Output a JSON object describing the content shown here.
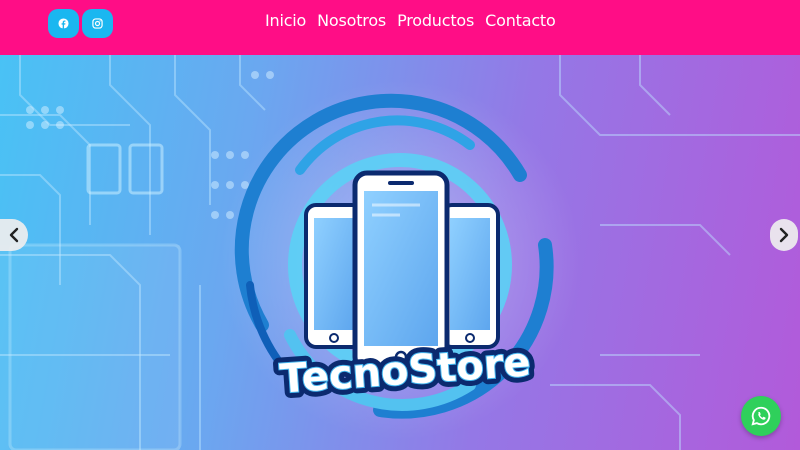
{
  "header": {
    "background": "#ff0d86",
    "social": [
      {
        "name": "facebook",
        "icon": "facebook-icon",
        "color": "#1ab7f0"
      },
      {
        "name": "instagram",
        "icon": "instagram-icon",
        "color": "#1ab7f0"
      }
    ],
    "nav": [
      "Inicio",
      "Nosotros",
      "Productos",
      "Contacto"
    ]
  },
  "hero": {
    "logo_text": "TecnoStore",
    "prev_icon": "chevron-left-icon",
    "next_icon": "chevron-right-icon",
    "colors": {
      "start": "#49c2f5",
      "end": "#b25ada",
      "ring": "#1e7fd1",
      "outline": "#0b2a6f"
    }
  },
  "floating": {
    "whatsapp_icon": "whatsapp-icon",
    "color": "#2fd05b"
  }
}
